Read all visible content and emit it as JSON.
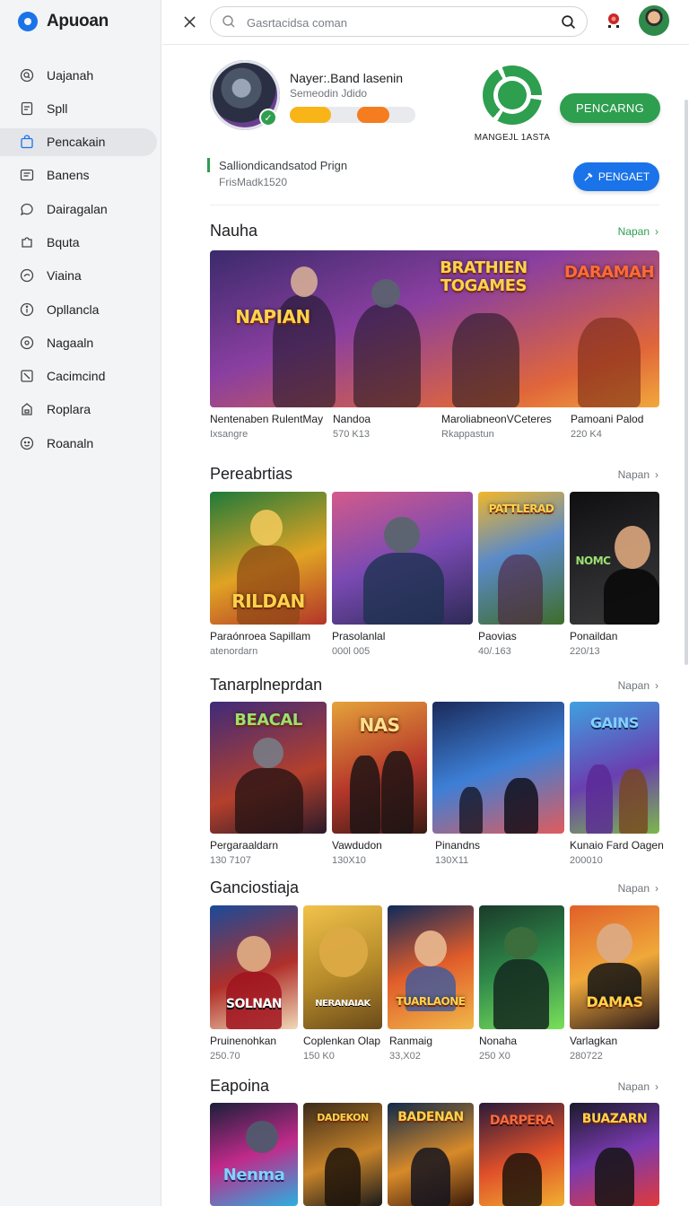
{
  "app": {
    "name": "Apuoan"
  },
  "sidebar": {
    "items": [
      {
        "label": "Uajanah",
        "icon": "search-circle-icon",
        "active": false
      },
      {
        "label": "Spll",
        "icon": "document-icon",
        "active": false
      },
      {
        "label": "Pencakain",
        "icon": "shopping-bag-icon",
        "active": true
      },
      {
        "label": "Banens",
        "icon": "mail-icon",
        "active": false
      },
      {
        "label": "Dairagalan",
        "icon": "chat-bubble-icon",
        "active": false
      },
      {
        "label": "Bquta",
        "icon": "puzzle-icon",
        "active": false
      },
      {
        "label": "Viaina",
        "icon": "message-icon",
        "active": false
      },
      {
        "label": "Opllancla",
        "icon": "circle-info-icon",
        "active": false
      },
      {
        "label": "Nagaaln",
        "icon": "target-icon",
        "active": false
      },
      {
        "label": "Cacimcind",
        "icon": "slash-square-icon",
        "active": false
      },
      {
        "label": "Roplara",
        "icon": "lock-icon",
        "active": false
      },
      {
        "label": "Roanaln",
        "icon": "smiley-icon",
        "active": false
      }
    ]
  },
  "topbar": {
    "search_placeholder": "Gasrtacidsa coman"
  },
  "profile": {
    "name": "Nayer:.Band lasenin",
    "subtitle": "Semeodin Jdido",
    "brand_caption": "MANGEJL 1ASTA",
    "primary_button": "PENCARNG",
    "info_title": "Salliondicandsatod Prign",
    "info_sub": "FrisMadk1520",
    "secondary_button": "PENGAET"
  },
  "sections": [
    {
      "title": "Nauha",
      "link": "Napan",
      "cards": [
        {
          "title": "Nentenaben RulentMay",
          "sub": "Ixsangre"
        },
        {
          "title": "Nandoa",
          "sub": "570 K13"
        },
        {
          "title": "MaroliabneonVCeteres",
          "sub": "Rkappastun"
        },
        {
          "title": "Pamoani Palod",
          "sub": "220 K4"
        }
      ],
      "banner_text_left": "NAPIAN",
      "banner_text_center": "BRATHIEN TOGAMES",
      "banner_text_right": "DARAMAH"
    },
    {
      "title": "Pereabrtias",
      "link": "Napan",
      "cards": [
        {
          "title": "Paraónroea Sapillam",
          "sub": "atenordarn",
          "art": "RILDAN"
        },
        {
          "title": "Prasolanlal",
          "sub": "000l 005",
          "art": ""
        },
        {
          "title": "Paovias",
          "sub": "40/.163",
          "art": "PATTLERAD"
        },
        {
          "title": "Ponaildan",
          "sub": "220/13",
          "art": "NOMC"
        }
      ]
    },
    {
      "title": "Tanarplneprdan",
      "link": "Napan",
      "cards": [
        {
          "title": "Pergaraaldarn",
          "sub": "130 7107",
          "art": "BEACAL"
        },
        {
          "title": "Vawdudon",
          "sub": "130X10",
          "art": "NAS"
        },
        {
          "title": "Pinandns",
          "sub": "130X11",
          "art": ""
        },
        {
          "title": "Kunaio Fard Oagen",
          "sub": "200010",
          "art": "GAINS"
        }
      ]
    },
    {
      "title": "Ganciostiaja",
      "link": "Napan",
      "cards": [
        {
          "title": "Pruinenohkan",
          "sub": "250.70",
          "art": "SOLNAN"
        },
        {
          "title": "Coplenkan Olap",
          "sub": "150 K0",
          "art": "NERANAIAK"
        },
        {
          "title": "Ranmaig",
          "sub": "33,X02",
          "art": "TUARLAONE"
        },
        {
          "title": "Nonaha",
          "sub": "250 X0",
          "art": ""
        },
        {
          "title": "Varlagkan",
          "sub": "280722",
          "art": "DAMAS"
        }
      ]
    },
    {
      "title": "Eapoina",
      "link": "Napan",
      "cards": [
        {
          "title": "",
          "sub": "",
          "art": "Nenma"
        },
        {
          "title": "",
          "sub": "",
          "art": "DADEKON"
        },
        {
          "title": "",
          "sub": "",
          "art": "BADENAN"
        },
        {
          "title": "",
          "sub": "",
          "art": "DARPERA"
        },
        {
          "title": "",
          "sub": "",
          "art": "BUAZARN"
        }
      ]
    }
  ],
  "colors": {
    "accent_green": "#2e9e4f",
    "accent_blue": "#1a73e8",
    "progress_yellow": "#f9b418",
    "progress_orange": "#f57c1f"
  }
}
